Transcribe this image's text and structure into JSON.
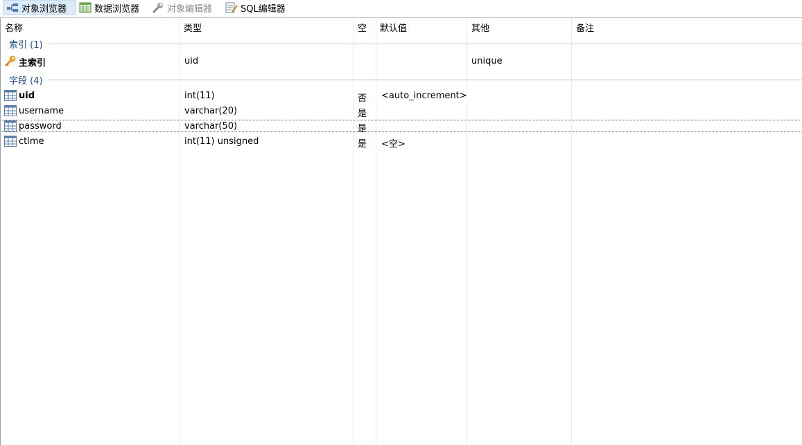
{
  "toolbar": {
    "object_browser": "对象浏览器",
    "data_browser": "数据浏览器",
    "object_editor": "对象编辑器",
    "sql_editor": "SQL编辑器"
  },
  "columns": [
    "名称",
    "类型",
    "空",
    "默认值",
    "其他",
    "备注"
  ],
  "indexes": {
    "section_label": "索引 (1)",
    "rows": [
      {
        "name": "主索引",
        "type": "uid",
        "null": "",
        "default": "",
        "other": "unique",
        "comment": ""
      }
    ]
  },
  "fields": {
    "section_label": "字段 (4)",
    "rows": [
      {
        "name": "uid",
        "type": "int(11)",
        "null": "否",
        "default": "<auto_increment>",
        "other": "",
        "comment": ""
      },
      {
        "name": "username",
        "type": "varchar(20)",
        "null": "是",
        "default": "",
        "other": "",
        "comment": ""
      },
      {
        "name": "password",
        "type": "varchar(50)",
        "null": "是",
        "default": "",
        "other": "",
        "comment": ""
      },
      {
        "name": "ctime",
        "type": "int(11) unsigned",
        "null": "是",
        "default": "<空>",
        "other": "",
        "comment": ""
      }
    ]
  },
  "colors": {
    "section_text": "#1f4f8f",
    "active_tab": "#dcebf8",
    "key_icon": "#e0a323"
  }
}
